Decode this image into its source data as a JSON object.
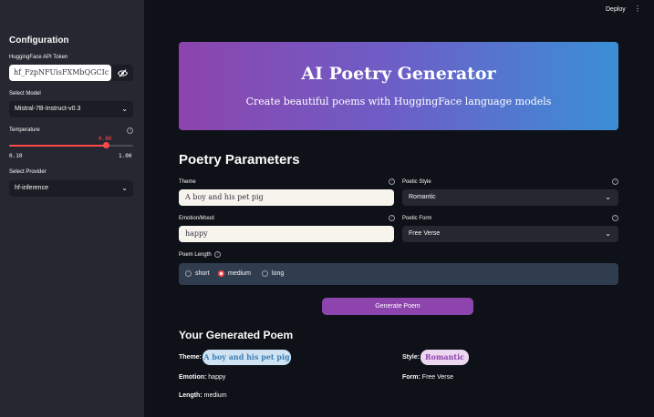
{
  "sidebar": {
    "title": "Configuration",
    "token_label": "HuggingFace API Token",
    "token_value": "hf_FzpNFUisFXMbQGCIc",
    "model_label": "Select Model",
    "model_value": "Mistral-7B-Instruct-v0.3",
    "temperature_label": "Temperature",
    "temperature_value": "0.80",
    "temperature_min": "0.10",
    "temperature_max": "1.00",
    "temperature_fraction": 0.778,
    "provider_label": "Select Provider",
    "provider_value": "hf-inference"
  },
  "topbar": {
    "deploy_label": "Deploy",
    "menu_glyph": "⋮"
  },
  "hero": {
    "title": "AI Poetry Generator",
    "subtitle": "Create beautiful poems with HuggingFace language models"
  },
  "params": {
    "heading": "Poetry Parameters",
    "theme_label": "Theme",
    "theme_value": "A boy and his pet pig",
    "style_label": "Poetic Style",
    "style_value": "Romantic",
    "emotion_label": "Emotion/Mood",
    "emotion_value": "happy",
    "form_label": "Poetic Form",
    "form_value": "Free Verse",
    "length_label": "Poem Length",
    "length_options": [
      "short",
      "medium",
      "long"
    ],
    "length_selected": "medium"
  },
  "generate_button": "Generate Poem",
  "result": {
    "heading": "Your Generated Poem",
    "theme_key": "Theme:",
    "theme_value": "A boy and his pet pig",
    "style_key": "Style:",
    "style_value": "Romantic",
    "emotion_key": "Emotion:",
    "emotion_value": "happy",
    "form_key": "Form:",
    "form_value": "Free Verse",
    "length_key": "Length:",
    "length_value": "medium"
  },
  "colors": {
    "accent": "#ff4b4b",
    "button": "#8e44ad",
    "theme_pill_bg": "#cfe3f3",
    "theme_pill_fg": "#3f7fb3",
    "style_pill_bg": "#ecd7f0",
    "style_pill_fg": "#8e44ad"
  }
}
